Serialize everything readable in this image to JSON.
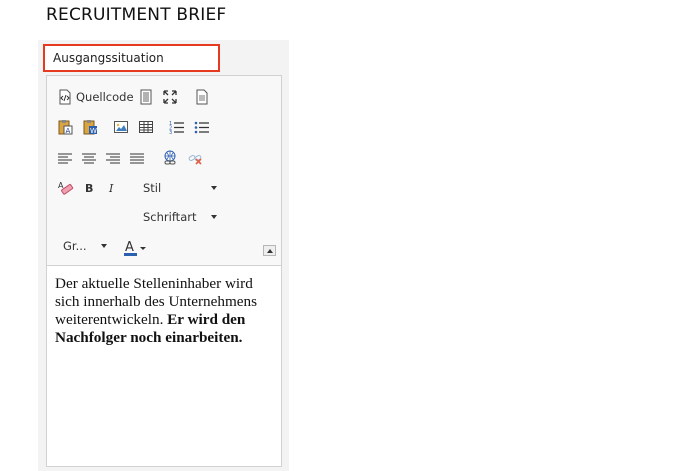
{
  "page": {
    "heading": "RECRUITMENT BRIEF"
  },
  "field": {
    "label": "Ausgangssituation"
  },
  "toolbar": {
    "source_label": "Quellcode",
    "style_combo": "Stil",
    "font_combo": "Schriftart",
    "size_combo": "Gr...",
    "icons": [
      "source-icon",
      "templates-icon",
      "maximize-icon",
      "document-icon",
      "paste-text-icon",
      "paste-word-icon",
      "image-icon",
      "table-icon",
      "numbered-list-icon",
      "bulleted-list-icon",
      "align-left-icon",
      "align-center-icon",
      "align-right-icon",
      "justify-icon",
      "link-icon",
      "unlink-icon",
      "remove-format-icon",
      "bold-icon",
      "italic-icon",
      "text-color-icon",
      "collapse-toolbar-icon"
    ]
  },
  "editor": {
    "text_plain": "Der aktuelle Stelleninhaber wird sich innerhalb des Unternehmens weiterentwickeln.",
    "text_bold": "Er wird den Nachfolger noch einarbeiten."
  },
  "colors": {
    "highlight_border": "#e53a1f",
    "panel_bg": "#f3f3f3"
  }
}
